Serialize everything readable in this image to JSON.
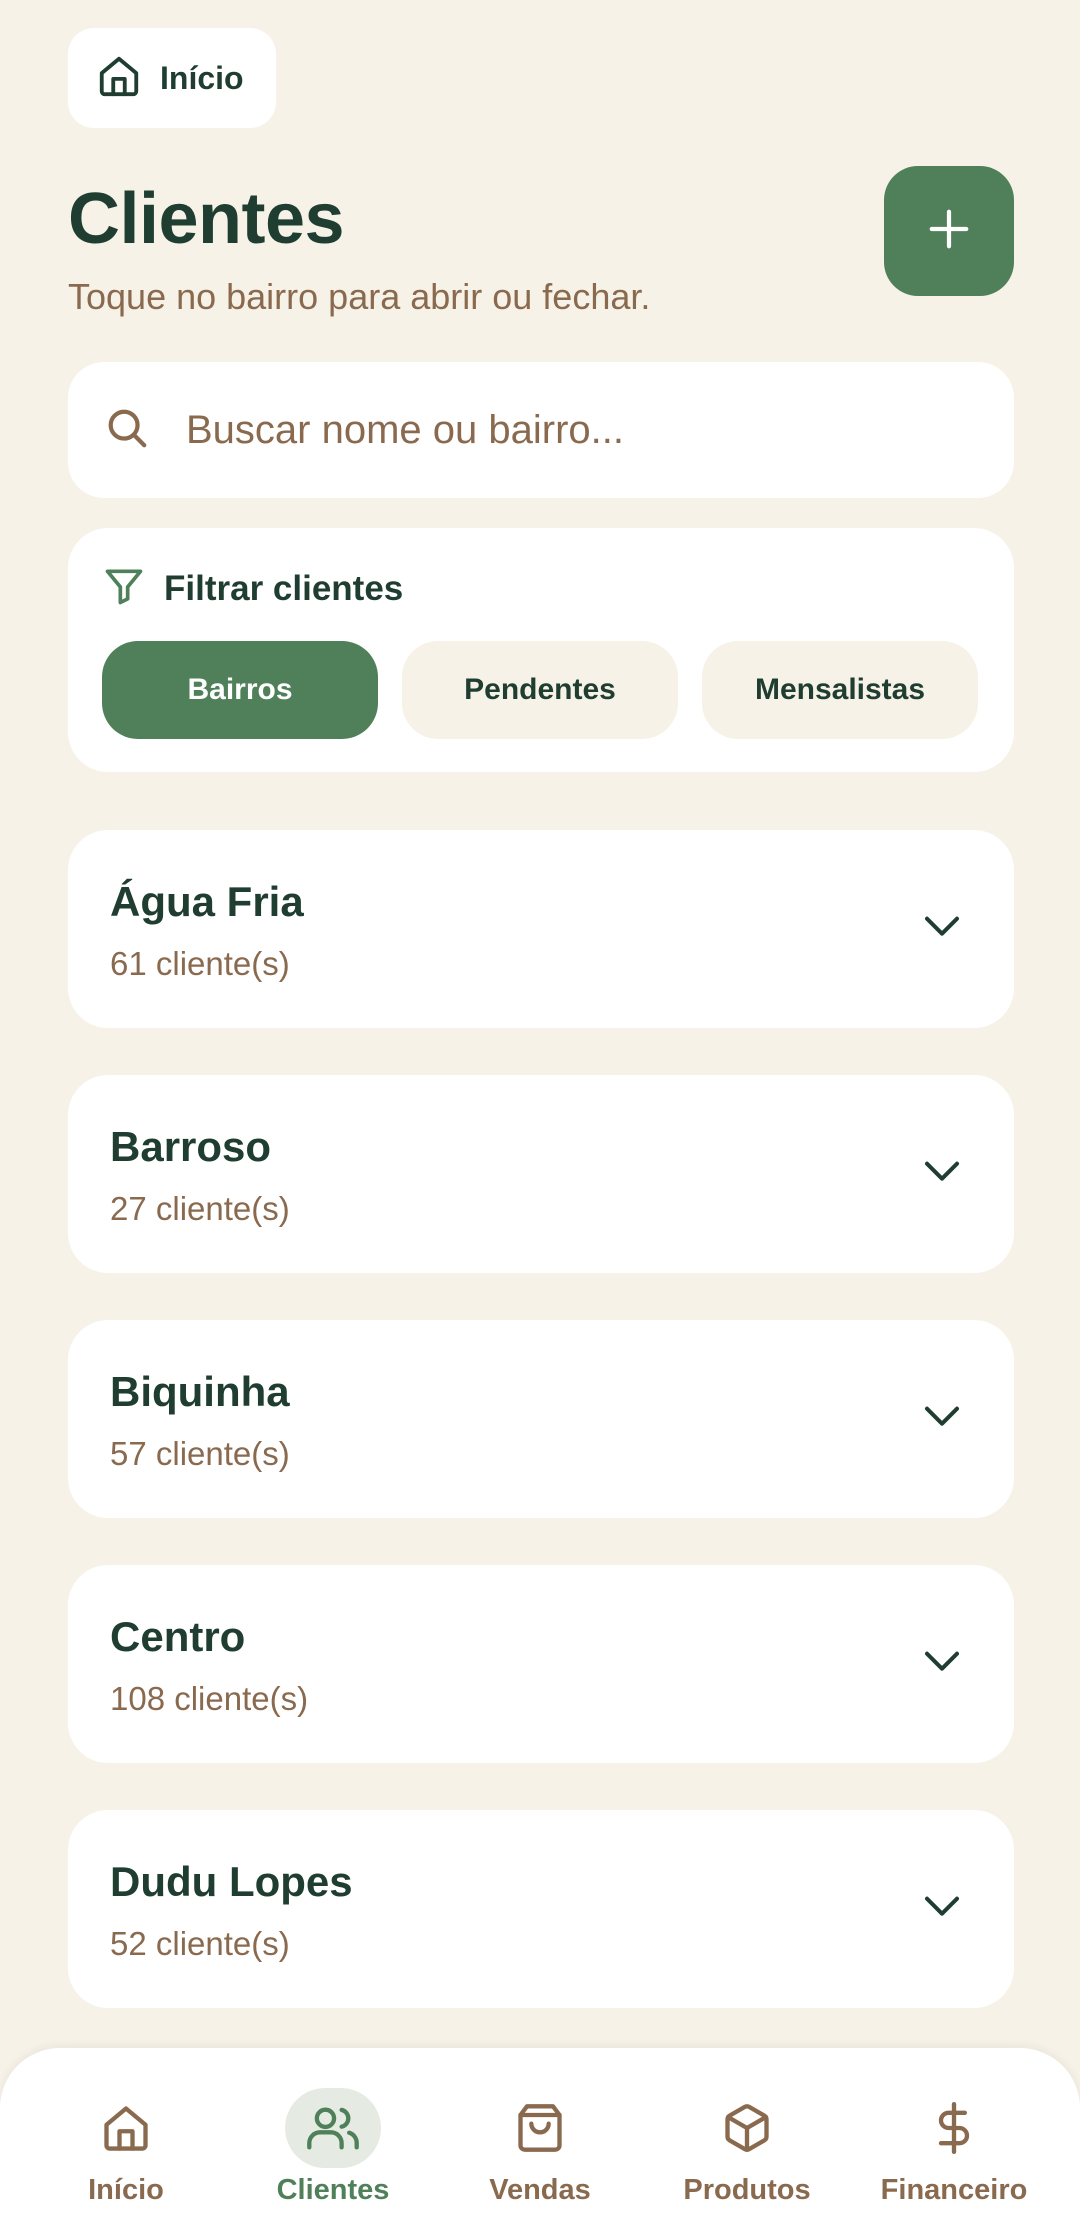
{
  "header": {
    "home_label": "Início",
    "title": "Clientes",
    "subtitle": "Toque no bairro para abrir ou fechar."
  },
  "search": {
    "placeholder": "Buscar nome ou bairro...",
    "value": ""
  },
  "filter": {
    "title": "Filtrar clientes",
    "options": [
      {
        "label": "Bairros",
        "active": true
      },
      {
        "label": "Pendentes",
        "active": false
      },
      {
        "label": "Mensalistas",
        "active": false
      }
    ]
  },
  "neighborhoods": [
    {
      "name": "Água Fria",
      "count": "61 cliente(s)"
    },
    {
      "name": "Barroso",
      "count": "27 cliente(s)"
    },
    {
      "name": "Biquinha",
      "count": "57 cliente(s)"
    },
    {
      "name": "Centro",
      "count": "108 cliente(s)"
    },
    {
      "name": "Dudu Lopes",
      "count": "52 cliente(s)"
    }
  ],
  "bottom_nav": [
    {
      "label": "Início",
      "icon": "home-icon",
      "active": false
    },
    {
      "label": "Clientes",
      "icon": "users-icon",
      "active": true
    },
    {
      "label": "Vendas",
      "icon": "shopping-bag-icon",
      "active": false
    },
    {
      "label": "Produtos",
      "icon": "box-icon",
      "active": false
    },
    {
      "label": "Financeiro",
      "icon": "dollar-icon",
      "active": false
    }
  ],
  "colors": {
    "background": "#f6f2e7",
    "primary_green": "#4f8059",
    "text_dark": "#1f3d30",
    "text_muted": "#8a6a4f",
    "card": "#ffffff"
  }
}
